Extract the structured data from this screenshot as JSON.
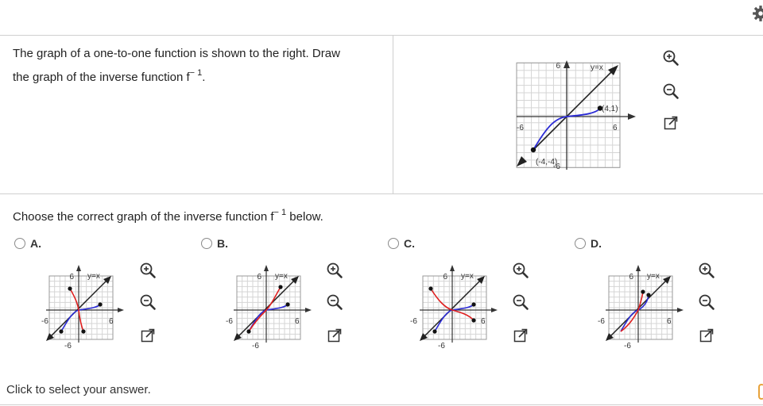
{
  "question": {
    "line1": "The graph of a one-to-one function is shown to the right. Draw",
    "line2": "the graph of the inverse function f",
    "line2_sup": "− 1",
    "line2_end": "."
  },
  "prompt": {
    "text": "Choose the correct graph of the inverse function f",
    "sup": "− 1",
    "text_end": " below."
  },
  "options": [
    {
      "letter": "A."
    },
    {
      "letter": "B."
    },
    {
      "letter": "C."
    },
    {
      "letter": "D."
    }
  ],
  "graph_labels": {
    "six": "6",
    "neg_six": "-6",
    "yx": "y=x",
    "point_pos": "(4,1)",
    "point_neg": "(-4,-4)"
  },
  "footer": {
    "hint": "Click to select your answer."
  },
  "icons": {
    "zoom_in": "zoom-in-icon",
    "zoom_out": "zoom-out-icon",
    "pop_out": "external-link-icon",
    "gear": "gear-icon"
  },
  "colors": {
    "function_curve": "#2b2bd6",
    "inverse_curve": "#e02020",
    "axis": "#333333",
    "grid": "#d5d5d5"
  }
}
